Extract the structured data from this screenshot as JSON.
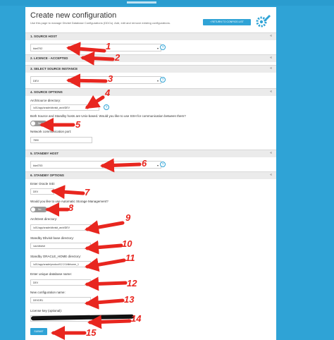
{
  "header": {
    "title": "Create new configuration",
    "subtitle": "Use this page to manage Dbvisit Database Configurations (DDCs). Add, edit and remove existing configurations.",
    "return_button": "RETURN TO CONFIGS LIST",
    "settings_icon": "gear-pencil-icon"
  },
  "sections": {
    "source_host": "1. SOURCE HOST",
    "licence": "2. LICENCE - ACCEPTED",
    "source_instance": "3. SELECT SOURCE INSTANCE",
    "source_options": "4. SOURCE OPTIONS",
    "standby_host": "5. STANDBY HOST",
    "standby_options": "6. STANDBY OPTIONS",
    "collapse_glyph": "«"
  },
  "fields": {
    "source_host_value": "kiwi702",
    "source_instance_value": "DEV",
    "archsource_label": "ArchSource directory:",
    "archsource_value": "/u01/app/oracle/dbvisit_arch/DEV",
    "unix_question": "Both Source and Standby hosts are Unix-based. Would you like to use SSH for communication between them?",
    "toggle_no": "No",
    "port_label": "Network communication port:",
    "port_value": "7890",
    "standby_host_value": "kiwi703",
    "sid_label": "Enter Oracle SID:",
    "sid_value": "DEV",
    "asm_question": "Would you like to use Automatic Storage Management?",
    "archdest_label": "ArchDest directory:",
    "archdest_value": "/u01/app/oracle/dbvisit_arch/DEV",
    "standby_base_label": "Standby Dbvisit base directory:",
    "standby_base_value": "/usr/dbvisit",
    "oracle_home_label": "Standby ORACLE_HOME directory:",
    "oracle_home_value": "/u01/app/oracle/product/12.2.0/dbhome_1",
    "unique_name_label": "Enter unique database name:",
    "unique_name_value": "DEV",
    "config_name_label": "New configuration name:",
    "config_name_value": "DEVDR1",
    "license_label": "License key (optional):",
    "submit_label": "SUBMIT",
    "help_glyph": "?",
    "caret_glyph": "▾"
  },
  "annotations": [
    "1",
    "2",
    "3",
    "4",
    "5",
    "6",
    "7",
    "8",
    "9",
    "10",
    "11",
    "12",
    "13",
    "14",
    "15"
  ],
  "colors": {
    "background": "#2fa3d6",
    "accent": "#2fa3d6",
    "annotation": "#e8261f"
  }
}
